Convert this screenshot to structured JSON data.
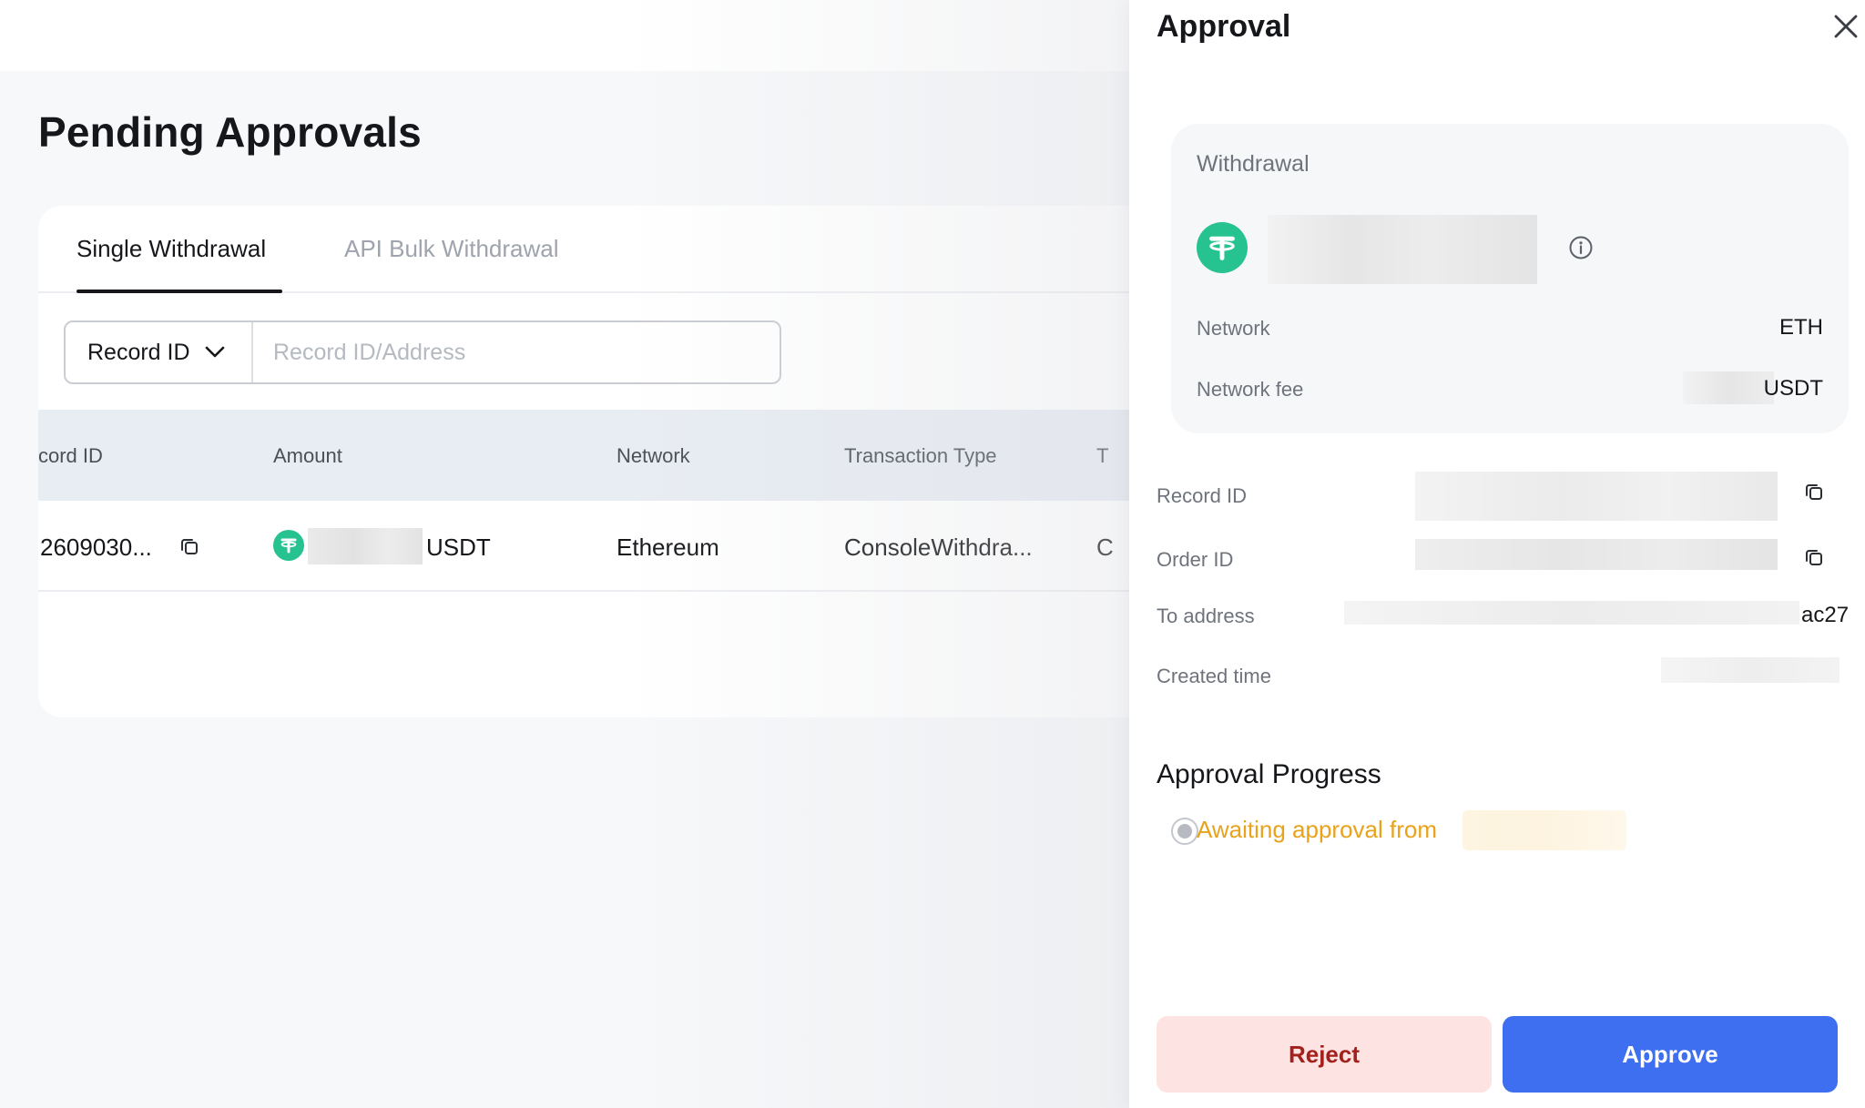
{
  "page": {
    "title": "Pending Approvals"
  },
  "tabs": [
    {
      "label": "Single Withdrawal",
      "active": true
    },
    {
      "label": "API Bulk Withdrawal",
      "active": false
    }
  ],
  "search": {
    "selected_field": "Record ID",
    "placeholder": "Record ID/Address"
  },
  "table": {
    "columns": [
      "cord ID",
      "Amount",
      "Network",
      "Transaction Type",
      "T"
    ],
    "rows": [
      {
        "record_id": "2609030...",
        "amount_currency": "USDT",
        "network": "Ethereum",
        "transaction_type": "ConsoleWithdra...",
        "extra": "C"
      }
    ]
  },
  "panel": {
    "title": "Approval",
    "withdrawal": {
      "label": "Withdrawal",
      "network_label": "Network",
      "network_value": "ETH",
      "fee_label": "Network fee",
      "fee_currency": "USDT"
    },
    "details": {
      "record_id_label": "Record ID",
      "order_id_label": "Order ID",
      "to_address_label": "To address",
      "to_address_suffix": "ac27",
      "created_time_label": "Created time"
    },
    "progress": {
      "title": "Approval Progress",
      "awaiting_text": "Awaiting approval from"
    },
    "buttons": {
      "reject": "Reject",
      "approve": "Approve"
    }
  },
  "colors": {
    "accent": "#3e6ff0",
    "reject_bg": "#fde4e2",
    "reject_text": "#a3201c",
    "usdt": "#26c28f",
    "awaiting": "#e9a21b"
  },
  "icons": [
    "chevron-down-icon",
    "copy-icon",
    "usdt-icon",
    "info-icon",
    "close-icon"
  ]
}
